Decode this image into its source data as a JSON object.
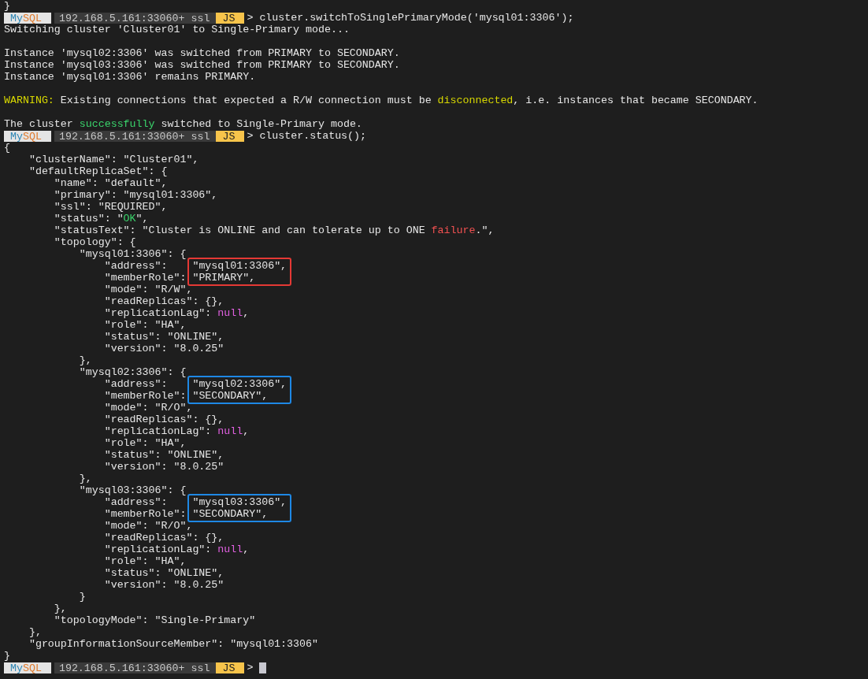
{
  "terminal": {
    "lines": [
      {
        "kind": "output",
        "segments": [
          {
            "text": "}"
          }
        ]
      },
      {
        "kind": "prompt",
        "brand_a": "My",
        "brand_b": "SQL",
        "host": "192.168.5.161:33060+ ssl",
        "mode": "JS",
        "symbol": ">",
        "command": "cluster.switchToSinglePrimaryMode('mysql01:3306');",
        "cursor": false
      },
      {
        "kind": "output",
        "segments": [
          {
            "text": "Switching cluster 'Cluster01' to Single-Primary mode..."
          }
        ]
      },
      {
        "kind": "blank"
      },
      {
        "kind": "output",
        "segments": [
          {
            "text": "Instance 'mysql02:3306' was switched from PRIMARY to SECONDARY."
          }
        ]
      },
      {
        "kind": "output",
        "segments": [
          {
            "text": "Instance 'mysql03:3306' was switched from PRIMARY to SECONDARY."
          }
        ]
      },
      {
        "kind": "output",
        "segments": [
          {
            "text": "Instance 'mysql01:3306' remains PRIMARY."
          }
        ]
      },
      {
        "kind": "blank"
      },
      {
        "kind": "output",
        "segments": [
          {
            "text": "WARNING:",
            "color": "#d7d700"
          },
          {
            "text": " Existing connections that expected a R/W connection must be "
          },
          {
            "text": "disconnected",
            "color": "#d7d700"
          },
          {
            "text": ", i.e. instances that became SECONDARY."
          }
        ]
      },
      {
        "kind": "blank"
      },
      {
        "kind": "output",
        "segments": [
          {
            "text": "The cluster "
          },
          {
            "text": "successfully",
            "color": "#3ad36b"
          },
          {
            "text": " switched to Single-Primary mode."
          }
        ]
      },
      {
        "kind": "prompt",
        "brand_a": "My",
        "brand_b": "SQL",
        "host": "192.168.5.161:33060+ ssl",
        "mode": "JS",
        "symbol": ">",
        "command": "cluster.status();",
        "cursor": false
      },
      {
        "kind": "output",
        "segments": [
          {
            "text": "{"
          }
        ]
      },
      {
        "kind": "output",
        "segments": [
          {
            "text": "    \"clusterName\": \"Cluster01\","
          }
        ]
      },
      {
        "kind": "output",
        "segments": [
          {
            "text": "    \"defaultReplicaSet\": {"
          }
        ]
      },
      {
        "kind": "output",
        "segments": [
          {
            "text": "        \"name\": \"default\","
          }
        ]
      },
      {
        "kind": "output",
        "segments": [
          {
            "text": "        \"primary\": \"mysql01:3306\","
          }
        ]
      },
      {
        "kind": "output",
        "segments": [
          {
            "text": "        \"ssl\": \"REQUIRED\","
          }
        ]
      },
      {
        "kind": "output",
        "segments": [
          {
            "text": "        \"status\": \""
          },
          {
            "text": "OK",
            "color": "#3ad36b"
          },
          {
            "text": "\","
          }
        ]
      },
      {
        "kind": "output",
        "segments": [
          {
            "text": "        \"statusText\": \"Cluster is ONLINE and can tolerate up to ONE "
          },
          {
            "text": "failure",
            "color": "#f05050"
          },
          {
            "text": ".\","
          }
        ]
      },
      {
        "kind": "output",
        "segments": [
          {
            "text": "        \"topology\": {"
          }
        ]
      },
      {
        "kind": "output",
        "segments": [
          {
            "text": "            \"mysql01:3306\": {"
          }
        ]
      },
      {
        "kind": "highlight",
        "color": "#e53935",
        "rows": [
          {
            "key": "                \"address\":",
            "value": "\"mysql01:3306\","
          },
          {
            "key": "                \"memberRole\":",
            "value": "\"PRIMARY\","
          }
        ]
      },
      {
        "kind": "output",
        "segments": [
          {
            "text": "                \"mode\": \"R/W\","
          }
        ]
      },
      {
        "kind": "output",
        "segments": [
          {
            "text": "                \"readReplicas\": {},"
          }
        ]
      },
      {
        "kind": "output",
        "segments": [
          {
            "text": "                \"replicationLag\": "
          },
          {
            "text": "null",
            "color": "#e060e0"
          },
          {
            "text": ","
          }
        ]
      },
      {
        "kind": "output",
        "segments": [
          {
            "text": "                \"role\": \"HA\","
          }
        ]
      },
      {
        "kind": "output",
        "segments": [
          {
            "text": "                \"status\": \"ONLINE\","
          }
        ]
      },
      {
        "kind": "output",
        "segments": [
          {
            "text": "                \"version\": \"8.0.25\""
          }
        ]
      },
      {
        "kind": "output",
        "segments": [
          {
            "text": "            },"
          }
        ]
      },
      {
        "kind": "output",
        "segments": [
          {
            "text": "            \"mysql02:3306\": {"
          }
        ]
      },
      {
        "kind": "highlight",
        "color": "#1e88e5",
        "rows": [
          {
            "key": "                \"address\":",
            "value": "\"mysql02:3306\","
          },
          {
            "key": "                \"memberRole\":",
            "value": "\"SECONDARY\","
          }
        ]
      },
      {
        "kind": "output",
        "segments": [
          {
            "text": "                \"mode\": \"R/O\","
          }
        ]
      },
      {
        "kind": "output",
        "segments": [
          {
            "text": "                \"readReplicas\": {},"
          }
        ]
      },
      {
        "kind": "output",
        "segments": [
          {
            "text": "                \"replicationLag\": "
          },
          {
            "text": "null",
            "color": "#e060e0"
          },
          {
            "text": ","
          }
        ]
      },
      {
        "kind": "output",
        "segments": [
          {
            "text": "                \"role\": \"HA\","
          }
        ]
      },
      {
        "kind": "output",
        "segments": [
          {
            "text": "                \"status\": \"ONLINE\","
          }
        ]
      },
      {
        "kind": "output",
        "segments": [
          {
            "text": "                \"version\": \"8.0.25\""
          }
        ]
      },
      {
        "kind": "output",
        "segments": [
          {
            "text": "            },"
          }
        ]
      },
      {
        "kind": "output",
        "segments": [
          {
            "text": "            \"mysql03:3306\": {"
          }
        ]
      },
      {
        "kind": "highlight",
        "color": "#1e88e5",
        "rows": [
          {
            "key": "                \"address\":",
            "value": "\"mysql03:3306\","
          },
          {
            "key": "                \"memberRole\":",
            "value": "\"SECONDARY\","
          }
        ]
      },
      {
        "kind": "output",
        "segments": [
          {
            "text": "                \"mode\": \"R/O\","
          }
        ]
      },
      {
        "kind": "output",
        "segments": [
          {
            "text": "                \"readReplicas\": {},"
          }
        ]
      },
      {
        "kind": "output",
        "segments": [
          {
            "text": "                \"replicationLag\": "
          },
          {
            "text": "null",
            "color": "#e060e0"
          },
          {
            "text": ","
          }
        ]
      },
      {
        "kind": "output",
        "segments": [
          {
            "text": "                \"role\": \"HA\","
          }
        ]
      },
      {
        "kind": "output",
        "segments": [
          {
            "text": "                \"status\": \"ONLINE\","
          }
        ]
      },
      {
        "kind": "output",
        "segments": [
          {
            "text": "                \"version\": \"8.0.25\""
          }
        ]
      },
      {
        "kind": "output",
        "segments": [
          {
            "text": "            }"
          }
        ]
      },
      {
        "kind": "output",
        "segments": [
          {
            "text": "        },"
          }
        ]
      },
      {
        "kind": "output",
        "segments": [
          {
            "text": "        \"topologyMode\": \"Single-Primary\""
          }
        ]
      },
      {
        "kind": "output",
        "segments": [
          {
            "text": "    },"
          }
        ]
      },
      {
        "kind": "output",
        "segments": [
          {
            "text": "    \"groupInformationSourceMember\": \"mysql01:3306\""
          }
        ]
      },
      {
        "kind": "output",
        "segments": [
          {
            "text": "}"
          }
        ]
      },
      {
        "kind": "prompt",
        "brand_a": "My",
        "brand_b": "SQL",
        "host": "192.168.5.161:33060+ ssl",
        "mode": "JS",
        "symbol": ">",
        "cursor": true
      }
    ]
  }
}
